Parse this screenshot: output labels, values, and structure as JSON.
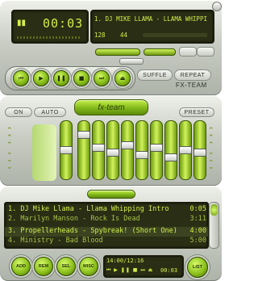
{
  "player": {
    "time": "00:03",
    "title_scroll": "1. DJ MIKE LLAMA - LLAMA WHIPPI",
    "kbps": "128",
    "khz": "44",
    "shuffle_label": "SUFFLE",
    "repeat_label": "REPEAT",
    "brand": "FX-TEAM"
  },
  "equalizer": {
    "on_label": "ON",
    "auto_label": "AUTO",
    "logo_text": "fx-team",
    "preset_label": "PRESET",
    "bands": [
      0.5,
      0.8,
      0.55,
      0.45,
      0.6,
      0.4,
      0.55,
      0.35,
      0.5,
      0.45
    ]
  },
  "playlist": {
    "items": [
      {
        "label": "1. DJ Mike Llama - Llama Whipping Intro",
        "time": "0:05"
      },
      {
        "label": "2. Marilyn Manson - Rock Is Dead",
        "time": "3:11"
      },
      {
        "label": "3. Propellerheads - Spybreak! (Short One)",
        "time": "4:00"
      },
      {
        "label": "4. Ministry - Bad Blood",
        "time": "5:00"
      }
    ],
    "buttons": {
      "add": "ADD",
      "rem": "REM",
      "sel": "SEL",
      "misc": "MISC",
      "list": "LIST"
    },
    "time_display": "14:00/12:16",
    "position_display": "00:03"
  },
  "colors": {
    "accent": "#8cc11c",
    "lcd": "#2a2e14",
    "lcd_text": "#d4ee4a"
  }
}
